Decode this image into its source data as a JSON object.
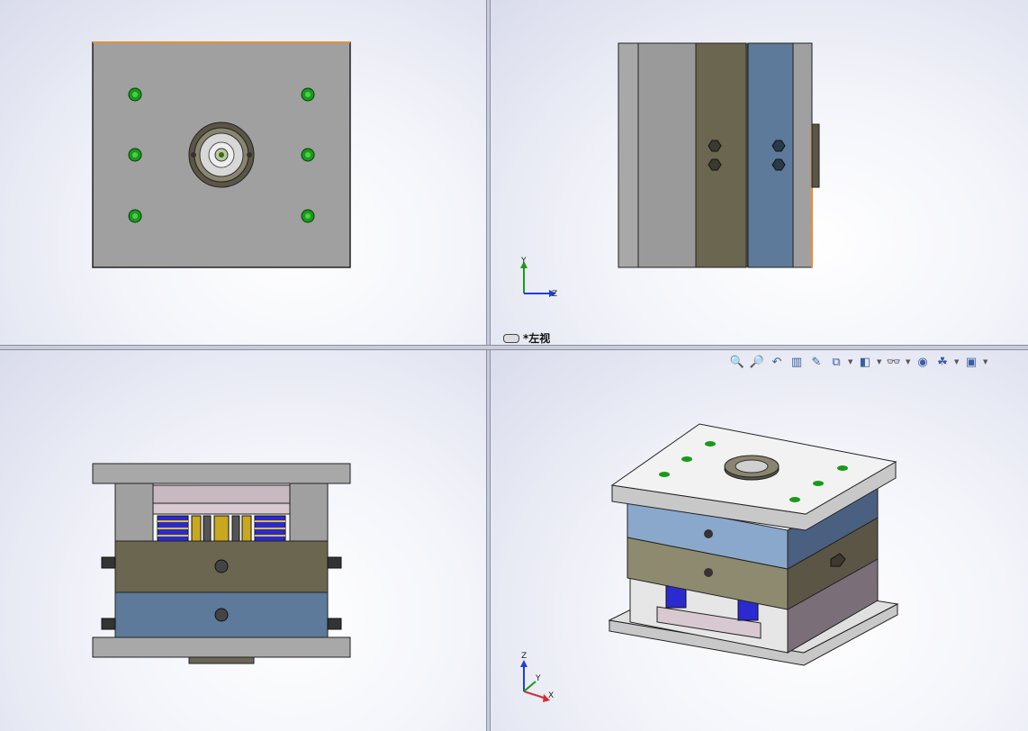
{
  "viewports": {
    "top_left": {
      "name": "front"
    },
    "top_right": {
      "name": "left",
      "label": "*左视"
    },
    "bottom_left": {
      "name": "top"
    },
    "bottom_right": {
      "name": "isometric"
    }
  },
  "triad_top_right": {
    "y": "Y",
    "z": "Z"
  },
  "triad_bottom_right": {
    "z": "Z",
    "y": "Y",
    "x": "X"
  },
  "heads_up_toolbar": [
    {
      "name": "zoom-to-fit-icon",
      "glyph": "🔍"
    },
    {
      "name": "zoom-to-area-icon",
      "glyph": "🔎"
    },
    {
      "name": "previous-view-icon",
      "glyph": "↶"
    },
    {
      "name": "section-view-icon",
      "glyph": "▥"
    },
    {
      "name": "dynamic-annotation-icon",
      "glyph": "✎"
    },
    {
      "name": "view-orientation-icon",
      "glyph": "⧉"
    },
    {
      "name": "display-style-icon",
      "glyph": "◧"
    },
    {
      "name": "hide-show-items-icon",
      "glyph": "👓"
    },
    {
      "name": "edit-appearance-icon",
      "glyph": "◉"
    },
    {
      "name": "apply-scene-icon",
      "glyph": "☘"
    },
    {
      "name": "view-settings-icon",
      "glyph": "▣"
    }
  ],
  "colors": {
    "plate_gray": "#a0a0a0",
    "a_plate": "#5d7a9a",
    "b_plate": "#6b6650",
    "bolt_green": "#1a9a1a",
    "spring_blue": "#2a2ad0",
    "edge_orange": "#e89030"
  }
}
